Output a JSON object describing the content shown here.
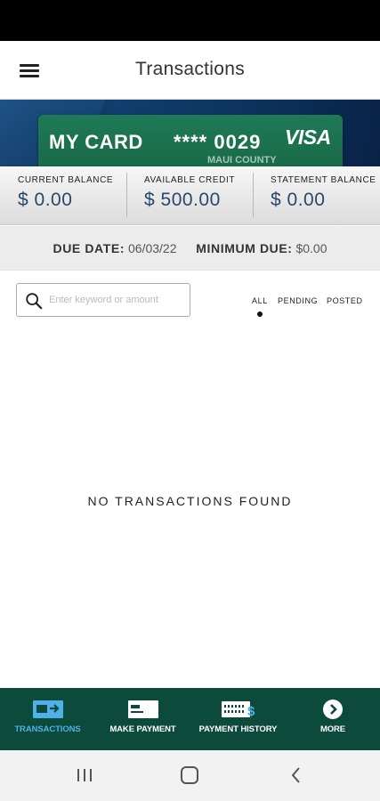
{
  "header": {
    "title": "Transactions"
  },
  "card": {
    "name": "MY CARD",
    "number": "**** 0029",
    "brand": "VISA",
    "issuer": "MAUI COUNTY"
  },
  "balances": [
    {
      "label": "CURRENT BALANCE",
      "value": "$ 0.00"
    },
    {
      "label": "AVAILABLE CREDIT",
      "value": "$ 500.00"
    },
    {
      "label": "STATEMENT BALANCE",
      "value": "$ 0.00"
    }
  ],
  "due": {
    "date_label": "DUE DATE:",
    "date_value": "06/03/22",
    "min_label": "MINIMUM DUE:",
    "min_value": "$0.00"
  },
  "search": {
    "placeholder": "Enter keyword or amount",
    "value": ""
  },
  "filters": {
    "items": [
      "ALL",
      "PENDING",
      "POSTED"
    ],
    "selected": "ALL"
  },
  "empty_message": "NO TRANSACTIONS FOUND",
  "bottom_nav": {
    "items": [
      {
        "label": "TRANSACTIONS",
        "icon": "transactions-icon",
        "active": true
      },
      {
        "label": "MAKE PAYMENT",
        "icon": "card-payment-icon",
        "active": false
      },
      {
        "label": "PAYMENT HISTORY",
        "icon": "payment-history-icon",
        "active": false
      },
      {
        "label": "MORE",
        "icon": "more-arrow-icon",
        "active": false
      }
    ]
  },
  "colors": {
    "nav_bg": "#0c4a3c",
    "active_nav": "#4fb1e8",
    "card_green": "#1f7a57",
    "balance_value": "#28486a"
  }
}
